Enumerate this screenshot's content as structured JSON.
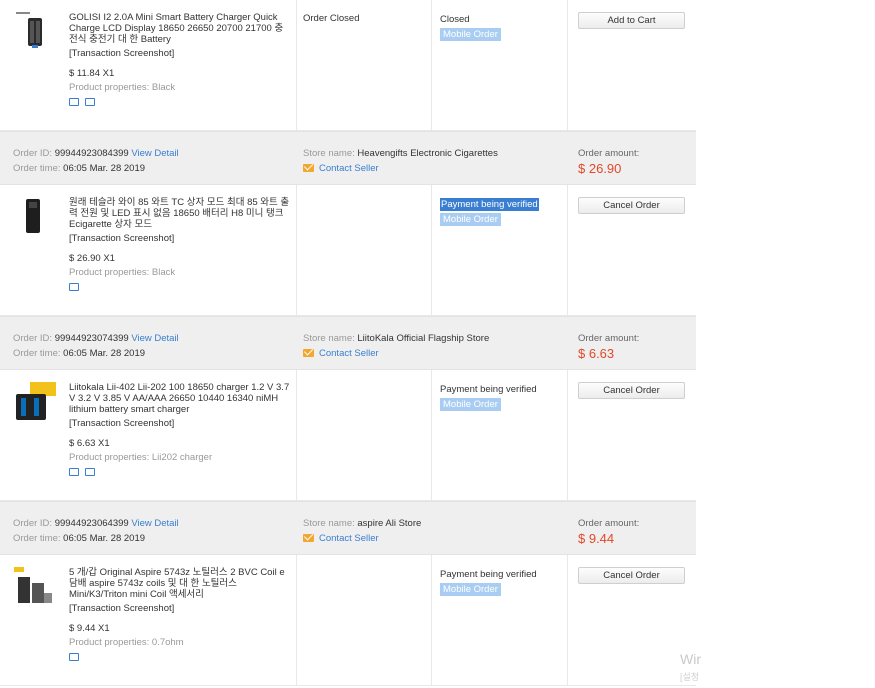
{
  "orders": [
    {
      "product": {
        "title": "GOLISI I2 2.0A Mini Smart Battery Charger Quick Charge LCD Display 18650 26650 20700 21700 충전식 충전기 대 한 Battery",
        "snapshot": "[Transaction Screenshot]",
        "price": "$ 11.84 X1",
        "properties": "Product properties: Black",
        "icons": [
          "truck-icon",
          "invoice-icon"
        ]
      },
      "order_status": "Order Closed",
      "status": "Closed",
      "badge": "Mobile Order",
      "action": "Add to Cart"
    },
    {
      "header": {
        "id_label": "Order ID:",
        "id": "99944923084399",
        "detail": "View Detail",
        "time_label": "Order time:",
        "time": "06:05 Mar. 28 2019",
        "store_label": "Store name:",
        "store": "Heavengifts Electronic Cigarettes",
        "contact": "Contact Seller",
        "amount_label": "Order amount:",
        "amount": "$ 26.90"
      },
      "product": {
        "title": "원래 테슬라 와이 85 와트 TC 상자 모드 최대 85 와트 출력 전원 및 LED 표시 없음 18650 배터리 H8 미니 탱크 Ecigarette 상자 모드",
        "snapshot": "[Transaction Screenshot]",
        "price": "$ 26.90 X1",
        "properties": "Product properties: Black",
        "icons": [
          "truck-icon"
        ]
      },
      "order_status": "",
      "status": "Payment being verified",
      "badge": "Mobile Order",
      "action": "Cancel Order"
    },
    {
      "header": {
        "id_label": "Order ID:",
        "id": "99944923074399",
        "detail": "View Detail",
        "time_label": "Order time:",
        "time": "06:05 Mar. 28 2019",
        "store_label": "Store name:",
        "store": "LiitoKala Official Flagship Store",
        "contact": "Contact Seller",
        "amount_label": "Order amount:",
        "amount": "$ 6.63"
      },
      "product": {
        "title": "Liitokala Lii-402 Lii-202 100 18650 charger 1.2 V 3.7 V 3.2 V 3.85 V AA/AAA 26650 10440 16340 niMH lithium battery smart charger",
        "snapshot": "[Transaction Screenshot]",
        "price": "$ 6.63 X1",
        "properties": "Product properties: Lii202 charger",
        "icons": [
          "truck-icon",
          "invoice-icon"
        ]
      },
      "order_status": "",
      "status": "Payment being verified",
      "badge": "Mobile Order",
      "action": "Cancel Order"
    },
    {
      "header": {
        "id_label": "Order ID:",
        "id": "99944923064399",
        "detail": "View Detail",
        "time_label": "Order time:",
        "time": "06:05 Mar. 28 2019",
        "store_label": "Store name:",
        "store": "aspire Ali Store",
        "contact": "Contact Seller",
        "amount_label": "Order amount:",
        "amount": "$ 9.44"
      },
      "product": {
        "title": "5 개/갑 Original Aspire 5743z 노틸러스 2 BVC Coil e 담배 aspire 5743z coils 및 대 한 노틸러스 Mini/K3/Triton mini Coil 액세서리",
        "snapshot": "[Transaction Screenshot]",
        "price": "$ 9.44 X1",
        "properties": "Product properties: 0.7ohm",
        "icons": [
          "truck-icon"
        ]
      },
      "order_status": "",
      "status": "Payment being verified",
      "badge": "Mobile Order",
      "action": "Cancel Order"
    }
  ],
  "watermark": {
    "line1": "Wir",
    "line2": "[설정"
  },
  "colors": {
    "link": "#3a7ed1",
    "amount": "#e2492a",
    "badge": "#a9cdf2",
    "header_bg": "#efefef"
  }
}
